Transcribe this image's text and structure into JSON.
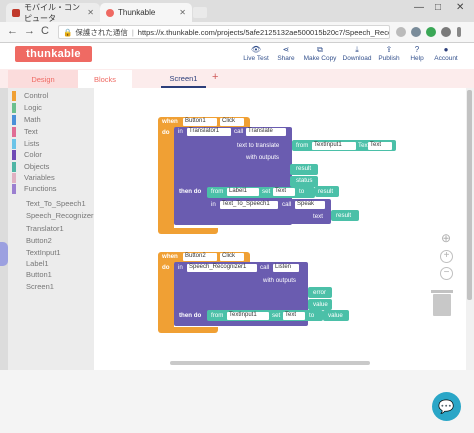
{
  "browser": {
    "tabs": [
      {
        "title": "モバイル・コンピュータ",
        "icon_color": "#c0392b"
      },
      {
        "title": "Thunkable",
        "icon_color": "#ef6a63"
      }
    ],
    "window_controls": {
      "minimize": "—",
      "maximize": "□",
      "close": "✕"
    },
    "back": "←",
    "forward": "→",
    "reload": "C",
    "lock_icon": "🔒",
    "security_label": "保護された通信",
    "url": "https://x.thunkable.com/projects/5afe2125132ae500015b20c7/Speech_Recognizer1..."
  },
  "app": {
    "logo": "thunkable",
    "toolbar": [
      {
        "icon": "eye-icon",
        "glyph": "👁",
        "label": "Live Test"
      },
      {
        "icon": "share-icon",
        "glyph": "⋖",
        "label": "Share"
      },
      {
        "icon": "copy-icon",
        "glyph": "⧉",
        "label": "Make Copy"
      },
      {
        "icon": "download-icon",
        "glyph": "⤓",
        "label": "Download"
      },
      {
        "icon": "publish-icon",
        "glyph": "⇪",
        "label": "Publish"
      },
      {
        "icon": "help-icon",
        "glyph": "?",
        "label": "Help"
      },
      {
        "icon": "account-icon",
        "glyph": "●",
        "label": "Account"
      }
    ],
    "tabs": {
      "design": "Design",
      "blocks": "Blocks",
      "screen": "Screen1",
      "add": "+"
    }
  },
  "palette": {
    "categories": [
      {
        "label": "Control",
        "color": "#f0a034"
      },
      {
        "label": "Logic",
        "color": "#6bbf8e"
      },
      {
        "label": "Math",
        "color": "#4a90d9"
      },
      {
        "label": "Text",
        "color": "#e06d95"
      },
      {
        "label": "Lists",
        "color": "#6bc4e8"
      },
      {
        "label": "Color",
        "color": "#6f4ab5"
      },
      {
        "label": "Objects",
        "color": "#4fb5a5"
      },
      {
        "label": "Variables",
        "color": "#e0b1c2"
      },
      {
        "label": "Functions",
        "color": "#9b7fd0"
      }
    ],
    "components": [
      "Text_To_Speech1",
      "Speech_Recognizer1",
      "Translator1",
      "Button2",
      "TextInput1",
      "Label1",
      "Button1",
      "Screen1"
    ]
  },
  "blocks": {
    "block1": {
      "when": "when",
      "button": "Button1",
      "event": "Click",
      "do": "do",
      "in": "in",
      "translator": "Translator1",
      "call": "call",
      "method": "Translate",
      "text_to_translate": "text to translate",
      "from": "from",
      "textinput": "TextInput1",
      "prop_text": "Text",
      "with_outputs": "with outputs",
      "result": "result",
      "status": "status",
      "then_do": "then do",
      "label": "Label1",
      "set": "set",
      "label_text": "Text",
      "to": "to",
      "result_var": "result",
      "tts": "Text_To_Speech1",
      "speak": "Speak",
      "text": "text",
      "result_var2": "result"
    },
    "block2": {
      "when": "when",
      "button": "Button2",
      "event": "Click",
      "do": "do",
      "in": "in",
      "recognizer": "Speech_Recognizer1",
      "call": "call",
      "method": "Listen",
      "with_outputs": "with outputs",
      "error": "error",
      "value": "value",
      "then_do": "then do",
      "from": "from",
      "textinput": "TextInput1",
      "set": "set",
      "prop_text": "Text",
      "to": "to",
      "value_var": "value"
    }
  },
  "workspace_controls": {
    "center": "⊕",
    "zoom_in": "+",
    "zoom_out": "−"
  },
  "chat_icon": "💬",
  "colors": {
    "event": "#f0a034",
    "component": "#6a5cb0",
    "variable": "#4bc0a8",
    "text_block": "#4bc0a8",
    "accent": "#ef6a63"
  }
}
